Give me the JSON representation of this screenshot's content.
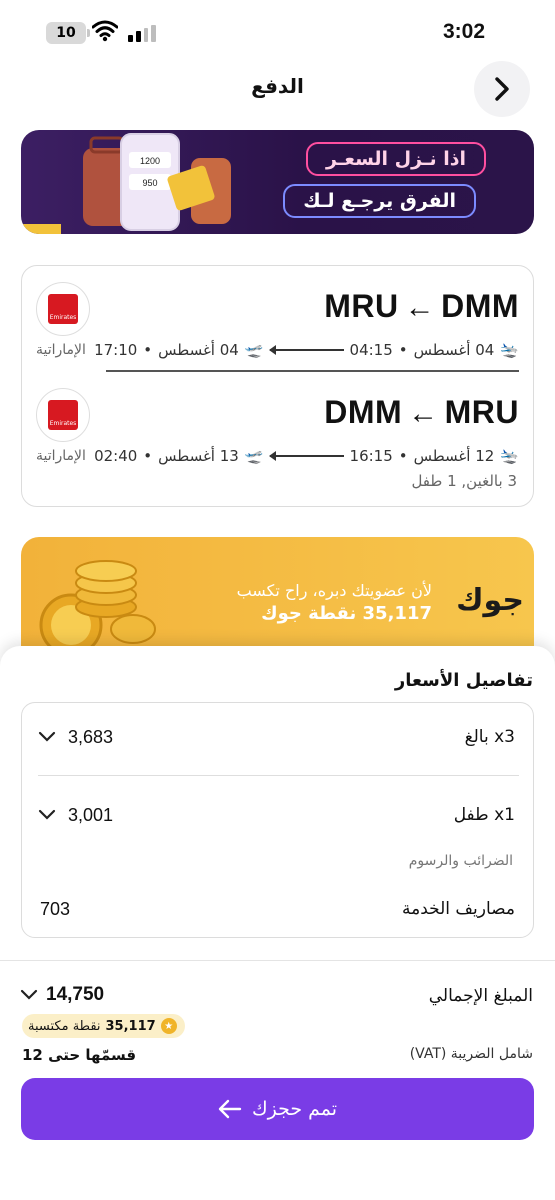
{
  "status_bar": {
    "battery": "10",
    "time": "3:02"
  },
  "header": {
    "title": "الدفع"
  },
  "promo": {
    "line1": "اذا نـزل السعـر",
    "line2": "الفرق يرجـع لـك",
    "phone_price_1": "1200",
    "phone_price_2": "950"
  },
  "flights": {
    "legs": [
      {
        "from": "DMM",
        "to": "MRU",
        "dep_date": "04 أغسطس",
        "dep_time": "04:15",
        "arr_date": "04 أغسطس",
        "arr_time": "17:10",
        "airline": "الإماراتية"
      },
      {
        "from": "MRU",
        "to": "DMM",
        "dep_date": "12 أغسطس",
        "dep_time": "16:15",
        "arr_date": "13 أغسطس",
        "arr_time": "02:40",
        "airline": "الإماراتية"
      }
    ],
    "passengers": "3 بالغين, 1 طفل"
  },
  "jood": {
    "brand": "جوك",
    "line1": "لأن عضويتك دبره، راح تكسب",
    "line2": "35,117 نقطة جوك"
  },
  "price_details": {
    "title": "تفاصيل الأسعار",
    "rows": [
      {
        "label": "x3 بالغ",
        "amount": "3,683"
      },
      {
        "label": "x1 طفل",
        "amount": "3,001"
      }
    ],
    "taxes_label": "الضرائب والرسوم",
    "service_label": "مصاريف الخدمة",
    "service_amount": "703"
  },
  "total": {
    "label": "المبلغ الإجمالي",
    "amount": "14,750",
    "points": "35,117",
    "points_label": "نقطة مكتسبة",
    "vat_note": "شامل الضريبة (VAT)",
    "installments": "قسمّها حتى 12"
  },
  "cta": {
    "label": "تمم حجزك"
  },
  "colors": {
    "accent": "#7a3ce6",
    "jood": "#f4b740",
    "promo_bg": "#2a1248",
    "emirates_red": "#d71921"
  }
}
